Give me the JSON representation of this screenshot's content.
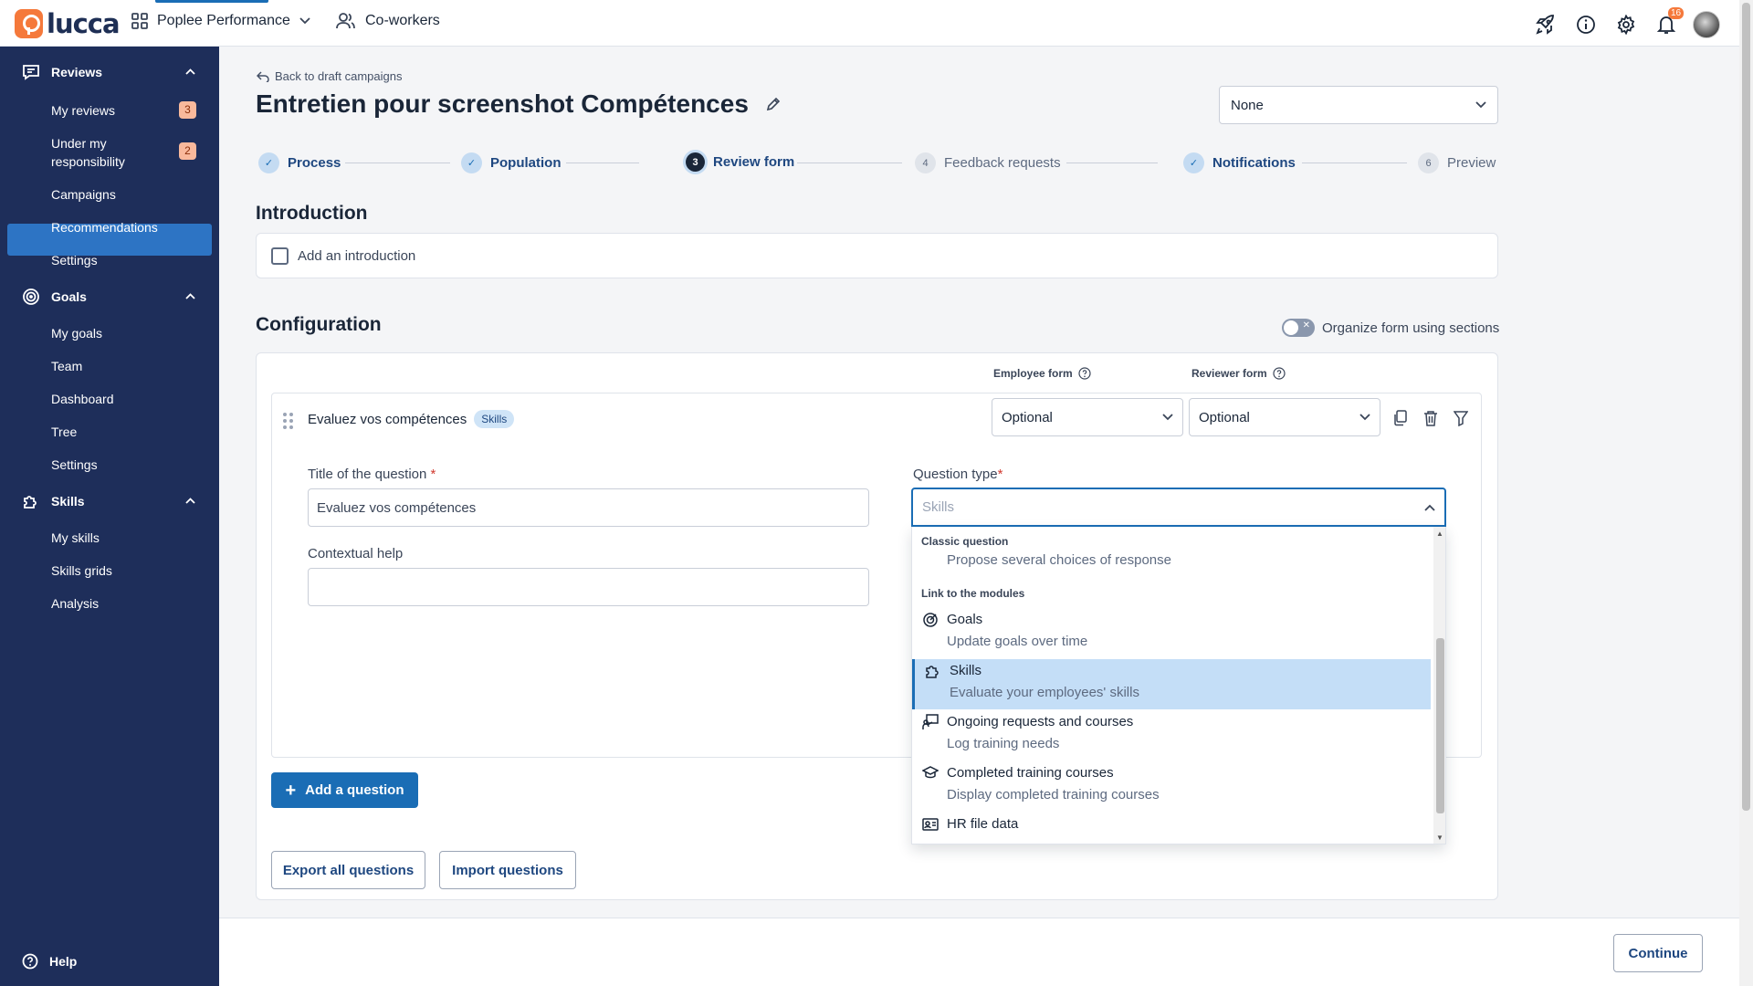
{
  "topbar": {
    "logo_text": "lucca",
    "app_name": "Poplee Performance",
    "coworkers_label": "Co-workers",
    "notification_count": "16",
    "icons": [
      "rocket-icon",
      "info-icon",
      "gear-icon",
      "bell-icon"
    ]
  },
  "sidebar": {
    "reviews": {
      "label": "Reviews",
      "items": [
        {
          "label": "My reviews",
          "badge": "3"
        },
        {
          "label": "Under my responsibility",
          "badge": "2"
        },
        {
          "label": "Campaigns"
        },
        {
          "label": "Recommendations"
        },
        {
          "label": "Settings"
        }
      ]
    },
    "goals": {
      "label": "Goals",
      "items": [
        {
          "label": "My goals"
        },
        {
          "label": "Team"
        },
        {
          "label": "Dashboard"
        },
        {
          "label": "Tree"
        },
        {
          "label": "Settings"
        }
      ]
    },
    "skills": {
      "label": "Skills",
      "items": [
        {
          "label": "My skills"
        },
        {
          "label": "Skills grids"
        },
        {
          "label": "Analysis"
        }
      ]
    },
    "help_label": "Help",
    "active_item": "Campaigns"
  },
  "page": {
    "back_link": "Back to draft campaigns",
    "title": "Entretien pour screenshot Compétences",
    "template_select": "None"
  },
  "stepper": [
    {
      "label": "Process",
      "state": "done",
      "num": "✓"
    },
    {
      "label": "Population",
      "state": "done",
      "num": "✓"
    },
    {
      "label": "Review form",
      "state": "current",
      "num": "3"
    },
    {
      "label": "Feedback requests",
      "state": "todo",
      "num": "4"
    },
    {
      "label": "Notifications",
      "state": "done",
      "num": "✓"
    },
    {
      "label": "Preview",
      "state": "todo",
      "num": "6"
    }
  ],
  "introduction": {
    "heading": "Introduction",
    "checkbox_label": "Add an introduction",
    "checked": false
  },
  "configuration": {
    "heading": "Configuration",
    "toggle_label": "Organize form using sections",
    "toggle_on": false,
    "employee_form_label": "Employee form",
    "reviewer_form_label": "Reviewer form",
    "question": {
      "title": "Evaluez vos compétences",
      "tag": "Skills",
      "employee_form_value": "Optional",
      "reviewer_form_value": "Optional",
      "title_label": "Title of the question",
      "title_value": "Evaluez vos compétences",
      "type_label": "Question type",
      "type_placeholder": "Skills",
      "help_label": "Contextual help",
      "help_value": ""
    },
    "dropdown": {
      "group_classic": "Classic question",
      "group_modules": "Link to the modules",
      "options": [
        {
          "title": "",
          "subtitle": "Propose several choices of response",
          "icon": ""
        },
        {
          "title": "Goals",
          "subtitle": "Update goals over time",
          "icon": "target-icon"
        },
        {
          "title": "Skills",
          "subtitle": "Evaluate your employees' skills",
          "icon": "puzzle-icon",
          "selected": true
        },
        {
          "title": "Ongoing requests and courses",
          "subtitle": "Log training needs",
          "icon": "training-board-icon"
        },
        {
          "title": "Completed training courses",
          "subtitle": "Display completed training courses",
          "icon": "graduation-cap-icon"
        },
        {
          "title": "HR file data",
          "subtitle": "",
          "icon": "id-card-icon"
        }
      ]
    },
    "add_question": "Add a question",
    "export_label": "Export all questions",
    "import_label": "Import questions"
  },
  "footer": {
    "continue_label": "Continue"
  },
  "colors": {
    "sidebar_bg": "#1e2e5a",
    "primary": "#1a6db5",
    "brand": "#f5793b"
  }
}
